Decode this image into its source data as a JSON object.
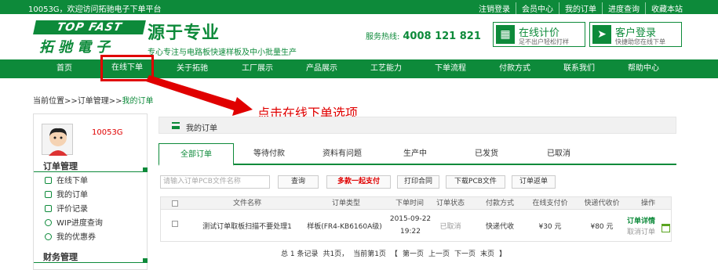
{
  "topbar": {
    "welcome": "10053G，欢迎访问拓驰电子下单平台",
    "links": [
      "注销登录",
      "会员中心",
      "我的订单",
      "进度查询",
      "收藏本站"
    ]
  },
  "header": {
    "logo_en": "TOP FAST",
    "logo_cn": "拓驰電子",
    "slogan_big": "源于专业",
    "slogan_small": "专心专注与电路板快速样板及中小批量生产",
    "hotline_label": "服务热线:",
    "hotline_number": "4008 121 821",
    "btn_price_title": "在线计价",
    "btn_price_sub": "足不出户轻松打样",
    "btn_login_title": "客户登录",
    "btn_login_sub": "快捷助您在线下单"
  },
  "nav": {
    "items": [
      "首页",
      "在线下单",
      "关于拓驰",
      "工厂展示",
      "产品展示",
      "工艺能力",
      "下单流程",
      "付款方式",
      "联系我们",
      "帮助中心"
    ],
    "highlighted": "在线下单"
  },
  "breadcrumb": {
    "prefix": "当前位置>>订单管理>>",
    "current": "我的订单"
  },
  "annotation": "点击在线下单选项",
  "sidebar": {
    "username": "10053G",
    "section1": "订单管理",
    "items": [
      "在线下单",
      "我的订单",
      "评价记录",
      "WIP进度查询",
      "我的优惠券"
    ],
    "section2": "财务管理",
    "accent": "#0d8a3a"
  },
  "main": {
    "title": "我的订单",
    "tabs": [
      "全部订单",
      "等待付款",
      "资料有问题",
      "生产中",
      "已发货",
      "已取消"
    ],
    "active_tab": "全部订单",
    "search_placeholder": "请输入订单PCB文件名称",
    "buttons": {
      "search": "查询",
      "multi_pay": "多款一起支付",
      "print": "打印合同",
      "download": "下载PCB文件",
      "return": "订单返单"
    },
    "table": {
      "headers": [
        "文件名称",
        "订单类型",
        "下单时间",
        "订单状态",
        "付款方式",
        "在线支付价",
        "快递代收价",
        "操作"
      ],
      "rows": [
        {
          "file": "测试订单取板扫描不要处理1",
          "type": "样板(FR4-KB6160A级)",
          "time_date": "2015-09-22",
          "time_clock": "19:22",
          "status": "已取消",
          "payment": "快递代收",
          "online_price": "¥30 元",
          "cod_price": "¥80 元",
          "op_detail": "订单详情",
          "op_cancel": "取消订单"
        }
      ]
    },
    "pager": {
      "total": "总 1 条记录",
      "pages": "共1页，",
      "current": "当前第1页",
      "lb": "【",
      "first": "第一页",
      "prev": "上一页",
      "next": "下一页",
      "last": "末页",
      "rb": "】"
    }
  },
  "colors": {
    "brand_green": "#0d8a3a",
    "highlight_red": "#e00000"
  }
}
